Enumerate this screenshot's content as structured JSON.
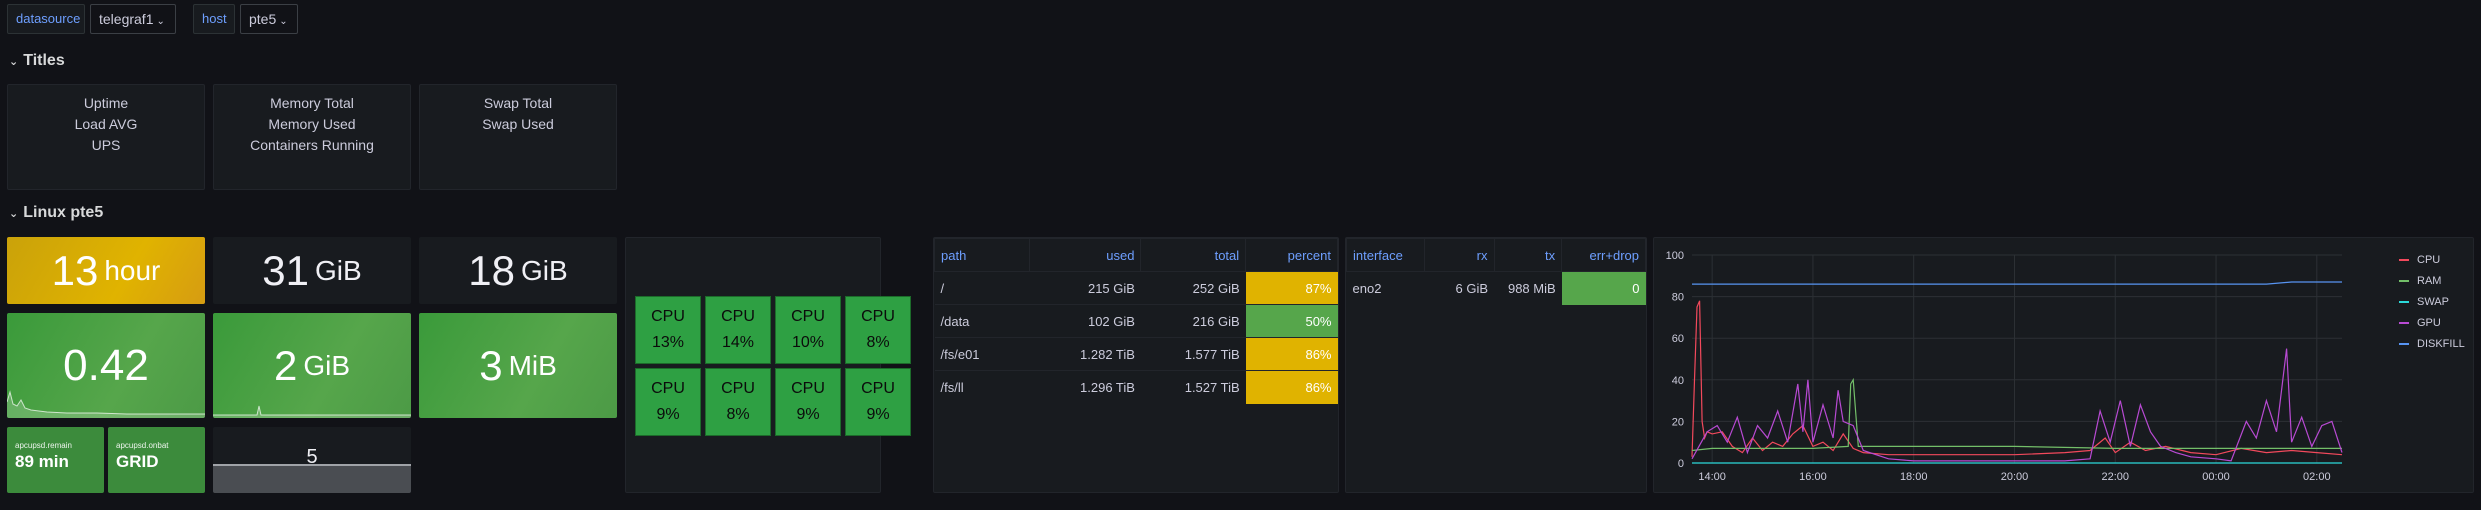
{
  "variables": [
    {
      "label": "datasource",
      "value": "telegraf1"
    },
    {
      "label": "host",
      "value": "pte5"
    }
  ],
  "rows": {
    "titles": "Titles",
    "linux": "Linux pte5"
  },
  "title_panels": [
    [
      "Uptime",
      "Load AVG",
      "UPS"
    ],
    [
      "Memory Total",
      "Memory Used",
      "Containers Running"
    ],
    [
      "Swap Total",
      "Swap Used"
    ]
  ],
  "stats": {
    "uptime": {
      "value": "13",
      "unit": "hour"
    },
    "mem_total": {
      "value": "31",
      "unit": "GiB"
    },
    "swap_total": {
      "value": "18",
      "unit": "GiB"
    },
    "load": {
      "value": "0.42",
      "unit": ""
    },
    "mem_used": {
      "value": "2",
      "unit": "GiB"
    },
    "swap_used": {
      "value": "3",
      "unit": "MiB"
    },
    "ups_remain": {
      "label": "apcupsd.remain",
      "value": "89 min"
    },
    "ups_onbat": {
      "label": "apcupsd.onbat",
      "value": "GRID"
    },
    "containers": {
      "value": "5"
    }
  },
  "cpu_grid": {
    "label": "CPU",
    "values": [
      "13%",
      "14%",
      "10%",
      "8%",
      "9%",
      "8%",
      "9%",
      "9%"
    ]
  },
  "disk_table": {
    "headers": [
      "path",
      "used",
      "total",
      "percent"
    ],
    "rows": [
      {
        "path": "/",
        "used": "215 GiB",
        "total": "252 GiB",
        "percent": "87%",
        "level": "warn"
      },
      {
        "path": "/data",
        "used": "102 GiB",
        "total": "216 GiB",
        "percent": "50%",
        "level": "ok"
      },
      {
        "path": "/fs/e01",
        "used": "1.282 TiB",
        "total": "1.577 TiB",
        "percent": "86%",
        "level": "warn"
      },
      {
        "path": "/fs/ll",
        "used": "1.296 TiB",
        "total": "1.527 TiB",
        "percent": "86%",
        "level": "warn"
      }
    ]
  },
  "net_table": {
    "headers": [
      "interface",
      "rx",
      "tx",
      "err+drop"
    ],
    "rows": [
      {
        "interface": "eno2",
        "rx": "6 GiB",
        "tx": "988 MiB",
        "errdrop": "0"
      }
    ]
  },
  "colors": {
    "warn": "#e0b300",
    "ok": "#56a64b",
    "cpu": "#f2495c",
    "ram": "#73bf69",
    "swap": "#2bd9d9",
    "gpu": "#b84ad3",
    "diskfill": "#5794f2"
  },
  "chart_data": {
    "type": "line",
    "x_ticks": [
      "14:00",
      "16:00",
      "18:00",
      "20:00",
      "22:00",
      "00:00",
      "02:00"
    ],
    "y_ticks": [
      "0",
      "20",
      "40",
      "60",
      "80",
      "100"
    ],
    "ylim": [
      0,
      100
    ],
    "grid": true,
    "legend_placement": "right",
    "x_hours": [
      13.6,
      2.5
    ],
    "series": [
      {
        "name": "CPU",
        "color": "#f2495c",
        "points": [
          [
            13.6,
            3
          ],
          [
            13.65,
            40
          ],
          [
            13.7,
            75
          ],
          [
            13.75,
            78
          ],
          [
            13.8,
            20
          ],
          [
            13.85,
            12
          ],
          [
            13.9,
            15
          ],
          [
            14.0,
            14
          ],
          [
            14.2,
            15
          ],
          [
            14.4,
            8
          ],
          [
            14.6,
            5
          ],
          [
            14.8,
            12
          ],
          [
            15.0,
            6
          ],
          [
            15.2,
            10
          ],
          [
            15.4,
            8
          ],
          [
            15.6,
            14
          ],
          [
            15.8,
            18
          ],
          [
            16.0,
            8
          ],
          [
            16.2,
            10
          ],
          [
            16.4,
            6
          ],
          [
            16.6,
            14
          ],
          [
            16.8,
            7
          ],
          [
            17.0,
            5
          ],
          [
            17.5,
            4
          ],
          [
            18.0,
            4
          ],
          [
            19.0,
            4
          ],
          [
            20.0,
            4
          ],
          [
            21.0,
            5
          ],
          [
            21.5,
            6
          ],
          [
            21.8,
            12
          ],
          [
            22.0,
            5
          ],
          [
            22.3,
            10
          ],
          [
            22.6,
            6
          ],
          [
            23.0,
            8
          ],
          [
            23.5,
            5
          ],
          [
            24.0,
            4
          ],
          [
            24.5,
            7
          ],
          [
            25.0,
            5
          ],
          [
            25.5,
            6
          ],
          [
            26.0,
            5
          ],
          [
            26.5,
            4
          ]
        ]
      },
      {
        "name": "RAM",
        "color": "#73bf69",
        "points": [
          [
            13.6,
            6
          ],
          [
            14.0,
            7
          ],
          [
            15.0,
            7
          ],
          [
            16.0,
            7
          ],
          [
            16.7,
            8
          ],
          [
            16.75,
            38
          ],
          [
            16.8,
            40
          ],
          [
            16.9,
            8
          ],
          [
            17.5,
            8
          ],
          [
            18.0,
            8
          ],
          [
            20.0,
            8
          ],
          [
            22.0,
            7
          ],
          [
            24.0,
            7
          ],
          [
            26.5,
            7
          ]
        ]
      },
      {
        "name": "SWAP",
        "color": "#2bd9d9",
        "points": [
          [
            13.6,
            0
          ],
          [
            26.5,
            0
          ]
        ]
      },
      {
        "name": "GPU",
        "color": "#b84ad3",
        "points": [
          [
            13.6,
            2
          ],
          [
            13.9,
            15
          ],
          [
            14.1,
            18
          ],
          [
            14.3,
            10
          ],
          [
            14.5,
            22
          ],
          [
            14.7,
            5
          ],
          [
            14.9,
            18
          ],
          [
            15.1,
            12
          ],
          [
            15.3,
            25
          ],
          [
            15.5,
            10
          ],
          [
            15.7,
            38
          ],
          [
            15.8,
            15
          ],
          [
            15.9,
            40
          ],
          [
            16.0,
            10
          ],
          [
            16.2,
            28
          ],
          [
            16.4,
            12
          ],
          [
            16.5,
            35
          ],
          [
            16.6,
            20
          ],
          [
            16.8,
            18
          ],
          [
            17.0,
            6
          ],
          [
            17.5,
            2
          ],
          [
            18.0,
            1
          ],
          [
            19.0,
            1
          ],
          [
            20.0,
            1
          ],
          [
            21.0,
            1
          ],
          [
            21.5,
            2
          ],
          [
            21.7,
            25
          ],
          [
            21.9,
            10
          ],
          [
            22.1,
            30
          ],
          [
            22.3,
            8
          ],
          [
            22.5,
            28
          ],
          [
            22.7,
            15
          ],
          [
            22.9,
            8
          ],
          [
            23.2,
            5
          ],
          [
            23.5,
            3
          ],
          [
            24.0,
            2
          ],
          [
            24.3,
            1
          ],
          [
            24.6,
            20
          ],
          [
            24.8,
            12
          ],
          [
            25.0,
            30
          ],
          [
            25.2,
            15
          ],
          [
            25.4,
            55
          ],
          [
            25.5,
            10
          ],
          [
            25.7,
            22
          ],
          [
            25.9,
            8
          ],
          [
            26.1,
            18
          ],
          [
            26.3,
            20
          ],
          [
            26.5,
            5
          ]
        ]
      },
      {
        "name": "DISKFILL",
        "color": "#5794f2",
        "points": [
          [
            13.6,
            86
          ],
          [
            18.0,
            86
          ],
          [
            22.0,
            86
          ],
          [
            24.0,
            86
          ],
          [
            25.0,
            86
          ],
          [
            25.5,
            87
          ],
          [
            26.5,
            87
          ]
        ]
      }
    ]
  }
}
